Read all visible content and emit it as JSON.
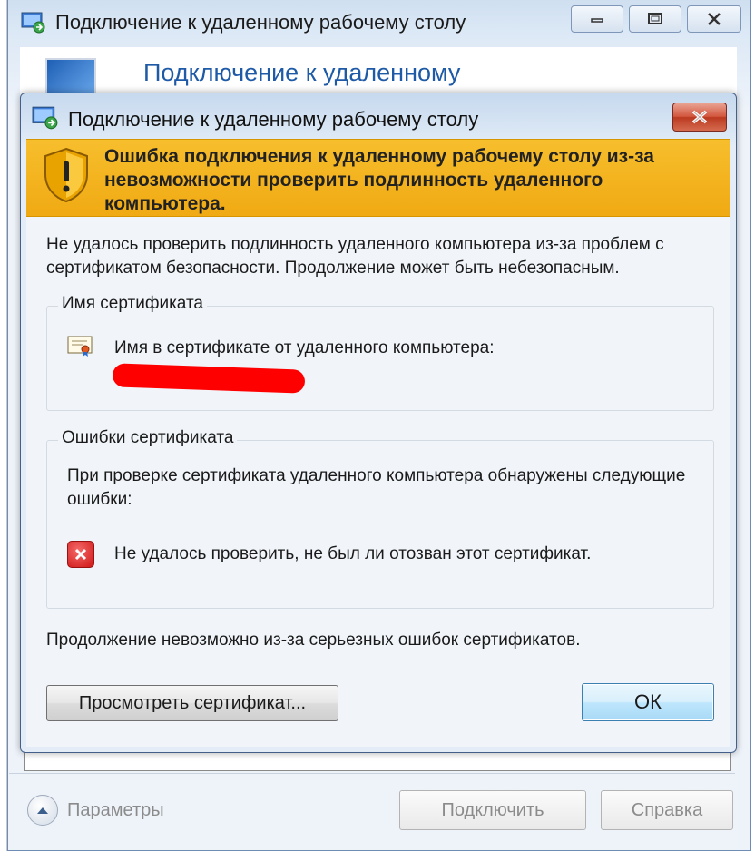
{
  "background_window": {
    "title": "Подключение к удаленному рабочему столу",
    "header_text": "Подключение к удаленному",
    "options_label": "Параметры",
    "connect_button": "Подключить",
    "help_button": "Справка"
  },
  "dialog": {
    "title": "Подключение к удаленному рабочему столу",
    "warning_title": "Ошибка подключения к удаленному рабочему столу из-за невозможности проверить подлинность удаленного компьютера.",
    "intro": "Не удалось проверить подлинность удаленного компьютера из-за проблем с сертификатом безопасности. Продолжение может быть небезопасным.",
    "cert_name_group": {
      "legend": "Имя сертификата",
      "label": "Имя в сертификате от удаленного компьютера:"
    },
    "cert_errors_group": {
      "legend": "Ошибки сертификата",
      "description": "При проверке сертификата удаленного компьютера обнаружены следующие ошибки:",
      "error_item": "Не удалось проверить, не был ли отозван этот сертификат."
    },
    "footer_note": "Продолжение невозможно из-за серьезных ошибок сертификатов.",
    "view_cert_button": "Просмотреть сертификат...",
    "ok_button": "ОК"
  },
  "colors": {
    "warning_banner": "#f2b21c",
    "redaction": "#ff0000",
    "error_icon": "#d41c1c"
  }
}
